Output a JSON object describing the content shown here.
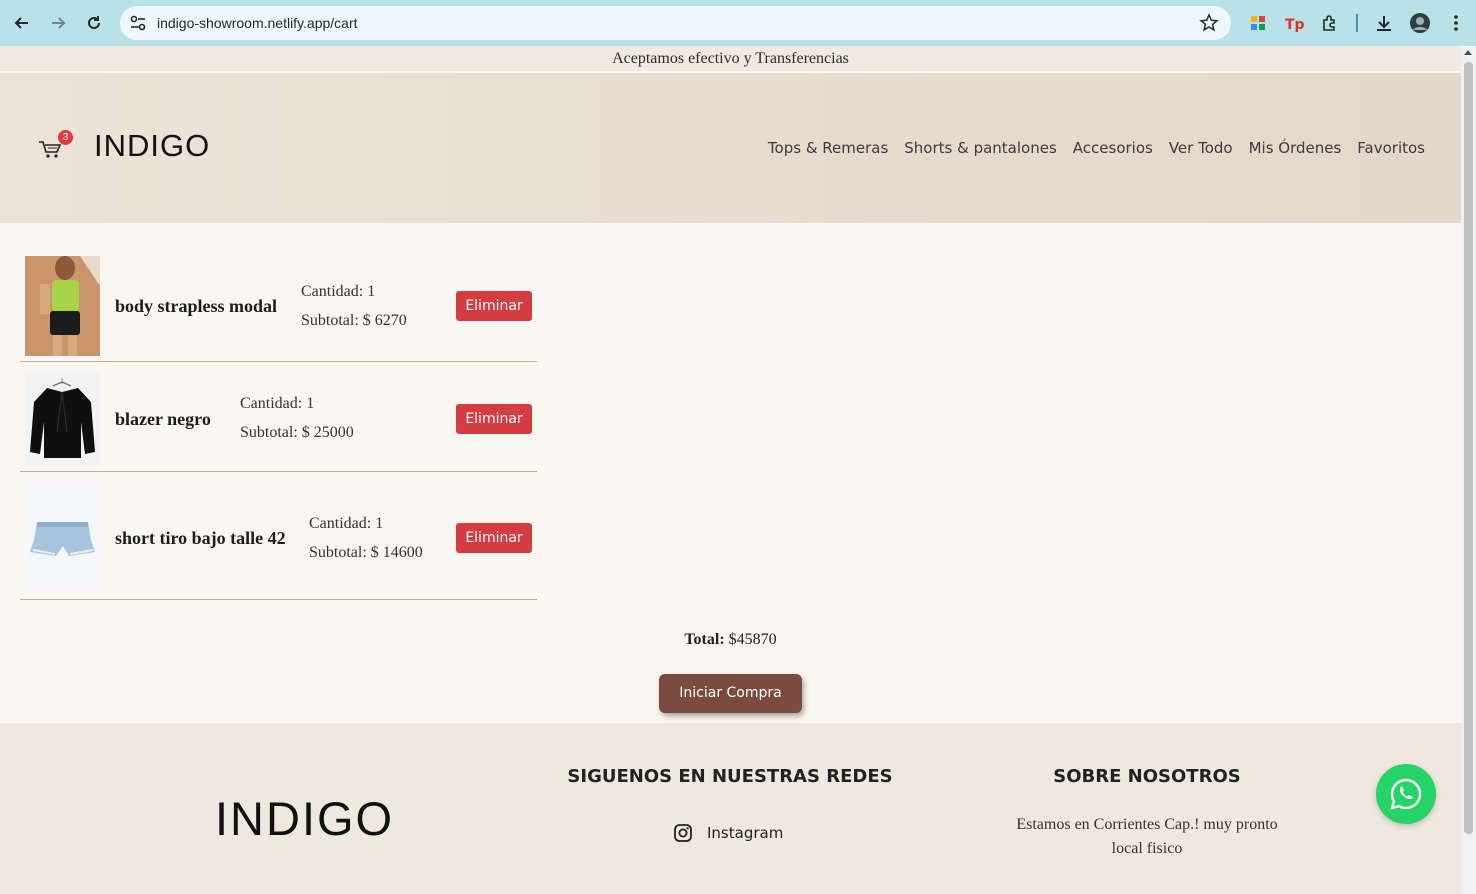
{
  "browser": {
    "url": "indigo-showroom.netlify.app/cart"
  },
  "promo_text": "Aceptamos efectivo y Transferencias",
  "header": {
    "brand": "INDIGO",
    "cart_count": "3",
    "nav": [
      "Tops & Remeras",
      "Shorts & pantalones",
      "Accesorios",
      "Ver Todo",
      "Mis Órdenes",
      "Favoritos"
    ]
  },
  "cart": {
    "items": [
      {
        "name": "body strapless modal",
        "quantity_label": "Cantidad: 1",
        "subtotal_label": "Subtotal: $ 6270",
        "remove_label": "Eliminar"
      },
      {
        "name": "blazer negro",
        "quantity_label": "Cantidad: 1",
        "subtotal_label": "Subtotal: $ 25000",
        "remove_label": "Eliminar"
      },
      {
        "name": "short tiro bajo talle 42",
        "quantity_label": "Cantidad: 1",
        "subtotal_label": "Subtotal: $ 14600",
        "remove_label": "Eliminar"
      }
    ],
    "total_label": "Total:",
    "total_value": "$45870",
    "checkout_label": "Iniciar Compra"
  },
  "footer": {
    "brand": "INDIGO",
    "social_title": "SIGUENOS EN NUESTRAS REDES",
    "instagram_label": "Instagram",
    "about_title": "SOBRE NOSOTROS",
    "about_text": "Estamos en Corrientes Cap.! muy pronto local fisico"
  },
  "colors": {
    "accent_brown": "#7a4b3e",
    "remove_red": "#d43c3f",
    "whatsapp_green": "#25d366",
    "chrome_teal": "#b9e1e8"
  }
}
